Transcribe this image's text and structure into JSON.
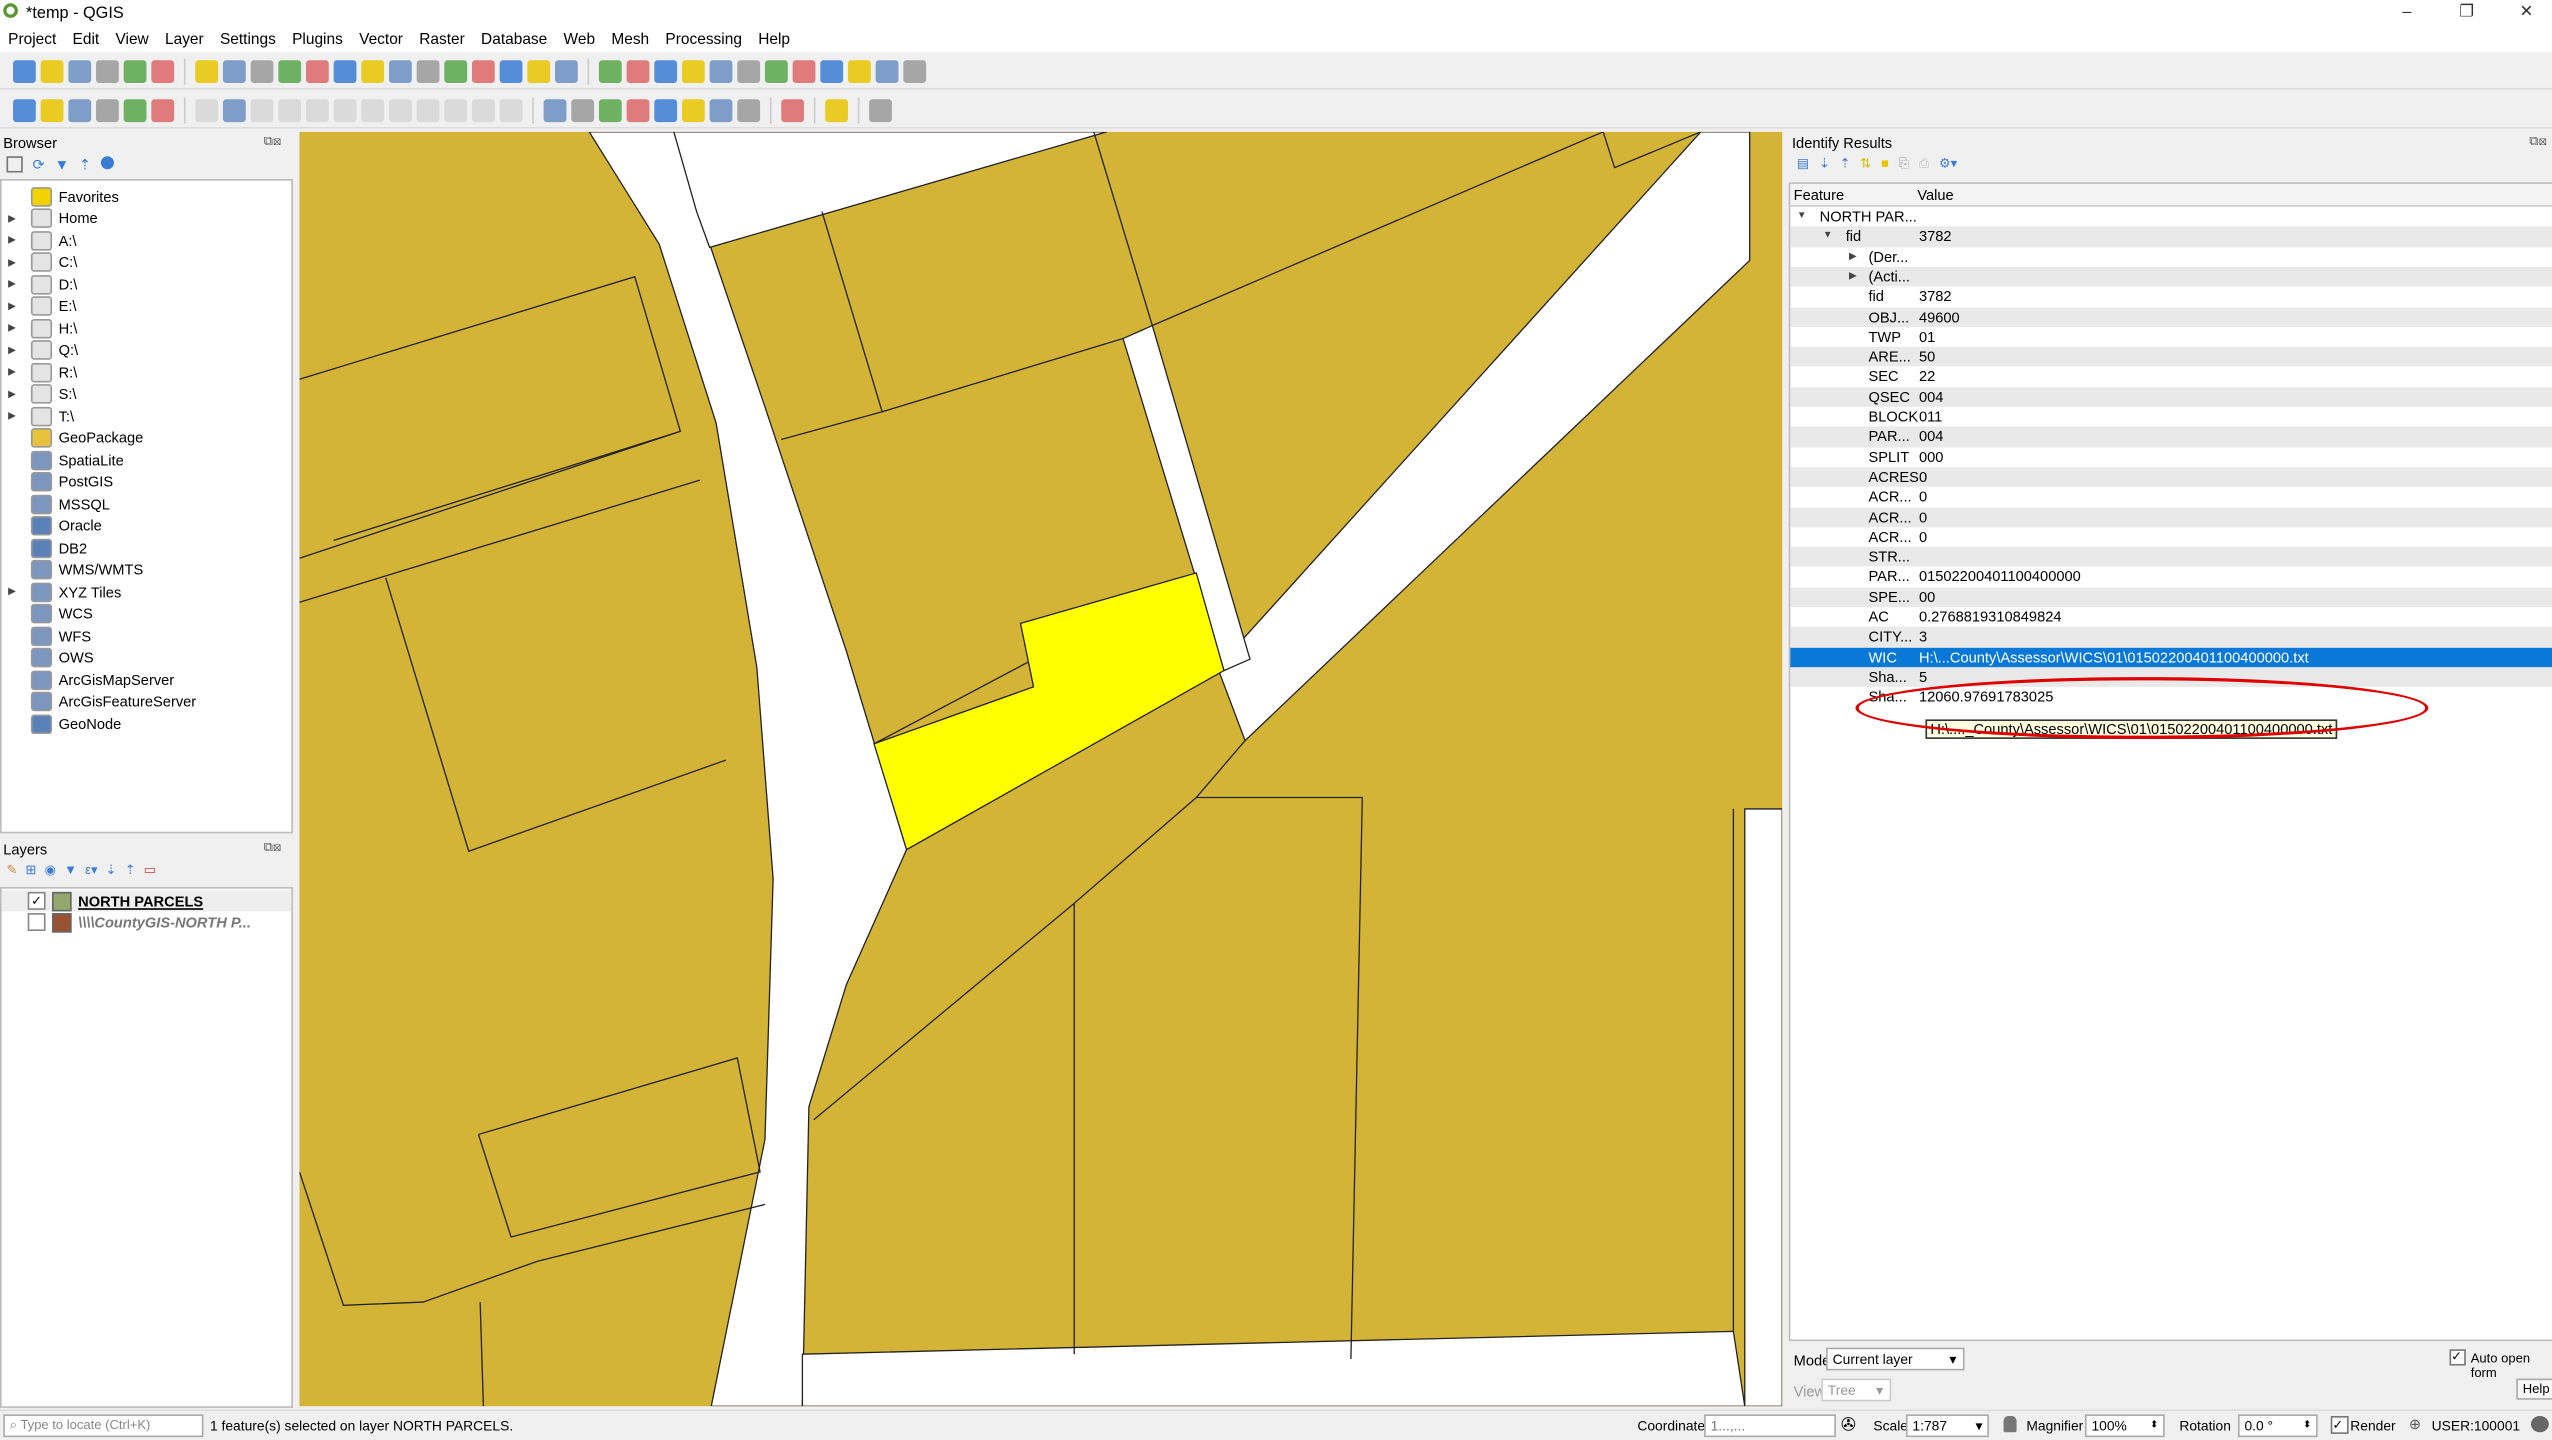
{
  "window": {
    "title": "*temp - QGIS",
    "controls": [
      "–",
      "❐",
      "✕"
    ]
  },
  "menu": [
    "Project",
    "Edit",
    "View",
    "Layer",
    "Settings",
    "Plugins",
    "Vector",
    "Raster",
    "Database",
    "Web",
    "Mesh",
    "Processing",
    "Help"
  ],
  "toolbar1": [
    "new-project",
    "open-project",
    "save-project",
    "save-as",
    "print-layout",
    "style-manager",
    "|",
    "pan",
    "pan-to-selection",
    "zoom-in",
    "zoom-out",
    "zoom-native",
    "zoom-full",
    "zoom-to-selection",
    "zoom-to-layer",
    "zoom-last",
    "zoom-next",
    "new-map-view",
    "new-3d-view",
    "temporal",
    "refresh",
    "|",
    "identify",
    "action",
    "select-features",
    "select-by-value",
    "deselect",
    "attribute-table",
    "field-calculator",
    "processing-toolbox",
    "statistics",
    "measure",
    "map-tips",
    "text-annotation"
  ],
  "toolbar2": [
    "data-source-manager",
    "new-geopackage-layer",
    "add-vector-layer",
    "add-spatialite",
    "add-virtual",
    "add-wms",
    "|",
    "digitize-pencil",
    "toggle-editing",
    "save-edits",
    "add-feature",
    "vertex-tool",
    "modify-attributes",
    "delete-selected",
    "cut-features",
    "copy-features",
    "paste-features",
    "undo",
    "redo",
    "|",
    "label-tool",
    "diagram-tool",
    "label-highlight",
    "pin-labels",
    "show-hide-labels",
    "move-label",
    "rotate-label",
    "change-label",
    "|",
    "plugin-globe",
    "|",
    "python-console",
    "|",
    "help"
  ],
  "browser": {
    "title": "Browser",
    "items": [
      {
        "label": "Favorites",
        "icon": "star-icon",
        "expandable": false
      },
      {
        "label": "Home",
        "icon": "home-folder-icon",
        "expandable": true
      },
      {
        "label": "A:\\",
        "icon": "folder-icon",
        "expandable": true
      },
      {
        "label": "C:\\",
        "icon": "folder-icon",
        "expandable": true
      },
      {
        "label": "D:\\",
        "icon": "folder-icon",
        "expandable": true
      },
      {
        "label": "E:\\",
        "icon": "folder-icon",
        "expandable": true
      },
      {
        "label": "H:\\",
        "icon": "folder-icon",
        "expandable": true
      },
      {
        "label": "Q:\\",
        "icon": "folder-icon",
        "expandable": true
      },
      {
        "label": "R:\\",
        "icon": "folder-icon",
        "expandable": true
      },
      {
        "label": "S:\\",
        "icon": "folder-icon",
        "expandable": true
      },
      {
        "label": "T:\\",
        "icon": "folder-icon",
        "expandable": true
      },
      {
        "label": "GeoPackage",
        "icon": "geopackage-icon",
        "expandable": false
      },
      {
        "label": "SpatiaLite",
        "icon": "spatialite-icon",
        "expandable": false
      },
      {
        "label": "PostGIS",
        "icon": "postgis-icon",
        "expandable": false
      },
      {
        "label": "MSSQL",
        "icon": "mssql-icon",
        "expandable": false
      },
      {
        "label": "Oracle",
        "icon": "oracle-icon",
        "expandable": false
      },
      {
        "label": "DB2",
        "icon": "db2-icon",
        "expandable": false
      },
      {
        "label": "WMS/WMTS",
        "icon": "globe-icon",
        "expandable": false
      },
      {
        "label": "XYZ Tiles",
        "icon": "globe-icon",
        "expandable": true
      },
      {
        "label": "WCS",
        "icon": "globe-icon",
        "expandable": false
      },
      {
        "label": "WFS",
        "icon": "globe-icon",
        "expandable": false
      },
      {
        "label": "OWS",
        "icon": "globe-icon",
        "expandable": false
      },
      {
        "label": "ArcGisMapServer",
        "icon": "globe-icon",
        "expandable": false
      },
      {
        "label": "ArcGisFeatureServer",
        "icon": "globe-icon",
        "expandable": false
      },
      {
        "label": "GeoNode",
        "icon": "geonode-icon",
        "expandable": false
      }
    ]
  },
  "layers": {
    "title": "Layers",
    "items": [
      {
        "label": "NORTH PARCELS",
        "checked": true,
        "color": "#94a86e"
      },
      {
        "label": "\\\\\\\\CountyGIS-NORTH P...",
        "checked": false,
        "color": "#9a5332"
      }
    ]
  },
  "identify": {
    "title": "Identify Results",
    "columns": [
      "Feature",
      "Value"
    ],
    "rows": [
      {
        "k": "NORTH PAR...",
        "v": "",
        "level": 0,
        "arrow": "▼"
      },
      {
        "k": "fid",
        "v": "3782",
        "level": 1,
        "arrow": "▼"
      },
      {
        "k": "(Der...",
        "v": "",
        "level": 2,
        "arrow": "▶"
      },
      {
        "k": "(Acti...",
        "v": "",
        "level": 2,
        "arrow": "▶"
      },
      {
        "k": "fid",
        "v": "3782",
        "level": 2
      },
      {
        "k": "OBJ...",
        "v": "49600",
        "level": 2
      },
      {
        "k": "TWP",
        "v": "01",
        "level": 2
      },
      {
        "k": "ARE...",
        "v": "50",
        "level": 2
      },
      {
        "k": "SEC",
        "v": "22",
        "level": 2
      },
      {
        "k": "QSEC",
        "v": "004",
        "level": 2
      },
      {
        "k": "BLOCK",
        "v": "011",
        "level": 2
      },
      {
        "k": "PAR...",
        "v": "004",
        "level": 2
      },
      {
        "k": "SPLIT",
        "v": "000",
        "level": 2
      },
      {
        "k": "ACRES",
        "v": "0",
        "level": 2
      },
      {
        "k": "ACR...",
        "v": "0",
        "level": 2
      },
      {
        "k": "ACR...",
        "v": "0",
        "level": 2
      },
      {
        "k": "ACR...",
        "v": "0",
        "level": 2
      },
      {
        "k": "STR...",
        "v": "",
        "level": 2
      },
      {
        "k": "PAR...",
        "v": "01502200401100400000",
        "level": 2
      },
      {
        "k": "SPE...",
        "v": "00",
        "level": 2
      },
      {
        "k": "AC",
        "v": "0.2768819310849824",
        "level": 2
      },
      {
        "k": "CITY...",
        "v": "3",
        "level": 2
      },
      {
        "k": "WIC",
        "v": "H:\\...County\\Assessor\\WICS\\01\\01502200401100400000.txt",
        "level": 2,
        "selected": true
      },
      {
        "k": "Sha...",
        "v": "5",
        "level": 2
      },
      {
        "k": "Sha...",
        "v": "12060.97691783025",
        "level": 2
      }
    ],
    "tooltip": "H:\\...._County\\Assessor\\WICS\\01\\01502200401100400000.txt",
    "mode_label": "Mode",
    "mode_value": "Current layer",
    "view_label": "View",
    "view_value": "Tree",
    "auto_open_label": "Auto open form",
    "auto_open_checked": true,
    "help_label": "Help"
  },
  "statusbar": {
    "locate_placeholder": "Type to locate (Ctrl+K)",
    "message": "1 feature(s) selected on layer NORTH PARCELS.",
    "coordinate_label": "Coordinate",
    "coordinate_value": "1...,...",
    "scale_label": "Scale",
    "scale_value": "1:787",
    "magnifier_label": "Magnifier",
    "magnifier_value": "100%",
    "rotation_label": "Rotation",
    "rotation_value": "0.0 °",
    "render_label": "Render",
    "render_checked": true,
    "crs": "USER:100001"
  },
  "colors": {
    "parcel": "#d4b437",
    "selected": "#ffff00",
    "selection_row": "#0a78d7",
    "annotation": "#e00000"
  }
}
